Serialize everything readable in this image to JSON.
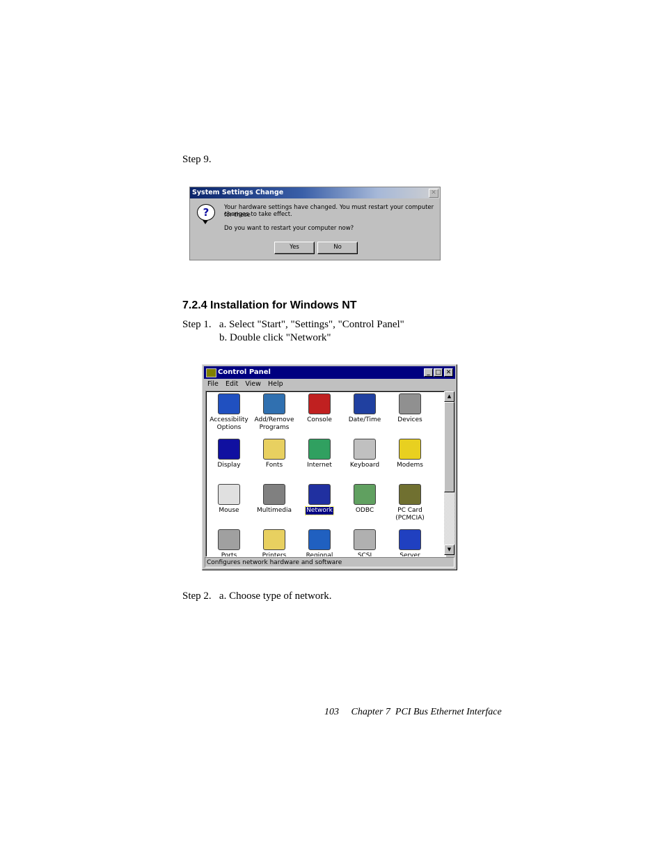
{
  "document": {
    "step9_label": "Step 9.",
    "section_heading": "7.2.4  Installation for Windows NT",
    "step1_line_a": "Step 1.   a. Select \"Start\", \"Settings\", \"Control Panel\"",
    "step1_line_b": "b. Double click \"Network\"",
    "step2_line": "Step 2.   a. Choose type of network.",
    "footer": "103     Chapter 7  PCI Bus Ethernet Interface"
  },
  "dialog": {
    "title": "System Settings Change",
    "close_glyph": "✕",
    "icon": "question-icon",
    "message_line1": "Your hardware settings have changed. You must restart your computer for these",
    "message_line2": "changes to take effect.",
    "question": "Do you want to restart your computer now?",
    "yes_label": "Yes",
    "no_label": "No"
  },
  "control_panel": {
    "title": "Control Panel",
    "menu": [
      "File",
      "Edit",
      "View",
      "Help"
    ],
    "items": [
      {
        "label": "Accessibility Options",
        "icon": "accessibility-icon"
      },
      {
        "label": "Add/Remove Programs",
        "icon": "add-remove-programs-icon"
      },
      {
        "label": "Console",
        "icon": "console-icon"
      },
      {
        "label": "Date/Time",
        "icon": "date-time-icon"
      },
      {
        "label": "Devices",
        "icon": "devices-icon"
      },
      {
        "label": "Display",
        "icon": "display-icon"
      },
      {
        "label": "Fonts",
        "icon": "fonts-icon"
      },
      {
        "label": "Internet",
        "icon": "internet-icon"
      },
      {
        "label": "Keyboard",
        "icon": "keyboard-icon"
      },
      {
        "label": "Modems",
        "icon": "modems-icon"
      },
      {
        "label": "Mouse",
        "icon": "mouse-icon"
      },
      {
        "label": "Multimedia",
        "icon": "multimedia-icon"
      },
      {
        "label": "Network",
        "icon": "network-icon",
        "selected": true
      },
      {
        "label": "ODBC",
        "icon": "odbc-icon"
      },
      {
        "label": "PC Card (PCMCIA)",
        "icon": "pc-card-icon"
      },
      {
        "label": "Ports",
        "icon": "ports-icon"
      },
      {
        "label": "Printers",
        "icon": "printers-icon"
      },
      {
        "label": "Regional",
        "icon": "regional-icon"
      },
      {
        "label": "SCSI Adapters",
        "icon": "scsi-adapters-icon"
      },
      {
        "label": "Server",
        "icon": "server-icon"
      }
    ],
    "status_text": "Configures network hardware and software"
  }
}
